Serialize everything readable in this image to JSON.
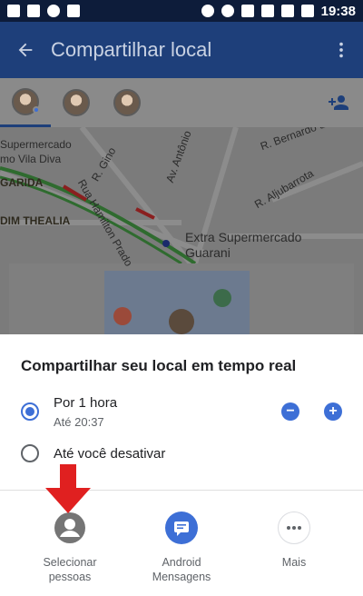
{
  "status_bar": {
    "time": "19:38"
  },
  "app_bar": {
    "title": "Compartilhar local",
    "back_icon": "arrow-back-icon",
    "more_icon": "more-vert-icon"
  },
  "contacts": {
    "add_person_icon": "person-add-icon"
  },
  "map": {
    "labels": [
      "Supermercado",
      "mo Vila Diva",
      "GARIDA",
      "DIM THEALIA",
      "Rua Hamilton Prado",
      "R. Gino",
      "Av. Antônio",
      "R. Bernardo de Lima",
      "R. Aljubarrota",
      "Extra Supermercado",
      "Guarani"
    ]
  },
  "sheet": {
    "title": "Compartilhar seu local em tempo real",
    "option1": {
      "label": "Por 1 hora",
      "sub": "Até 20:37",
      "minus": "−",
      "plus": "+"
    },
    "option2": {
      "label": "Até você desativar"
    },
    "share": [
      {
        "label": "Selecionar pessoas",
        "icon": "account-circle-icon",
        "color": "#757575"
      },
      {
        "label": "Android Mensagens",
        "icon": "messages-icon",
        "color": "#3d6fd6"
      },
      {
        "label": "Mais",
        "icon": "more-horiz-icon",
        "color": "#ffffff"
      }
    ]
  },
  "colors": {
    "accent": "#3d6fd6",
    "app_bar": "#1e3f7a",
    "arrow": "#e02020"
  }
}
